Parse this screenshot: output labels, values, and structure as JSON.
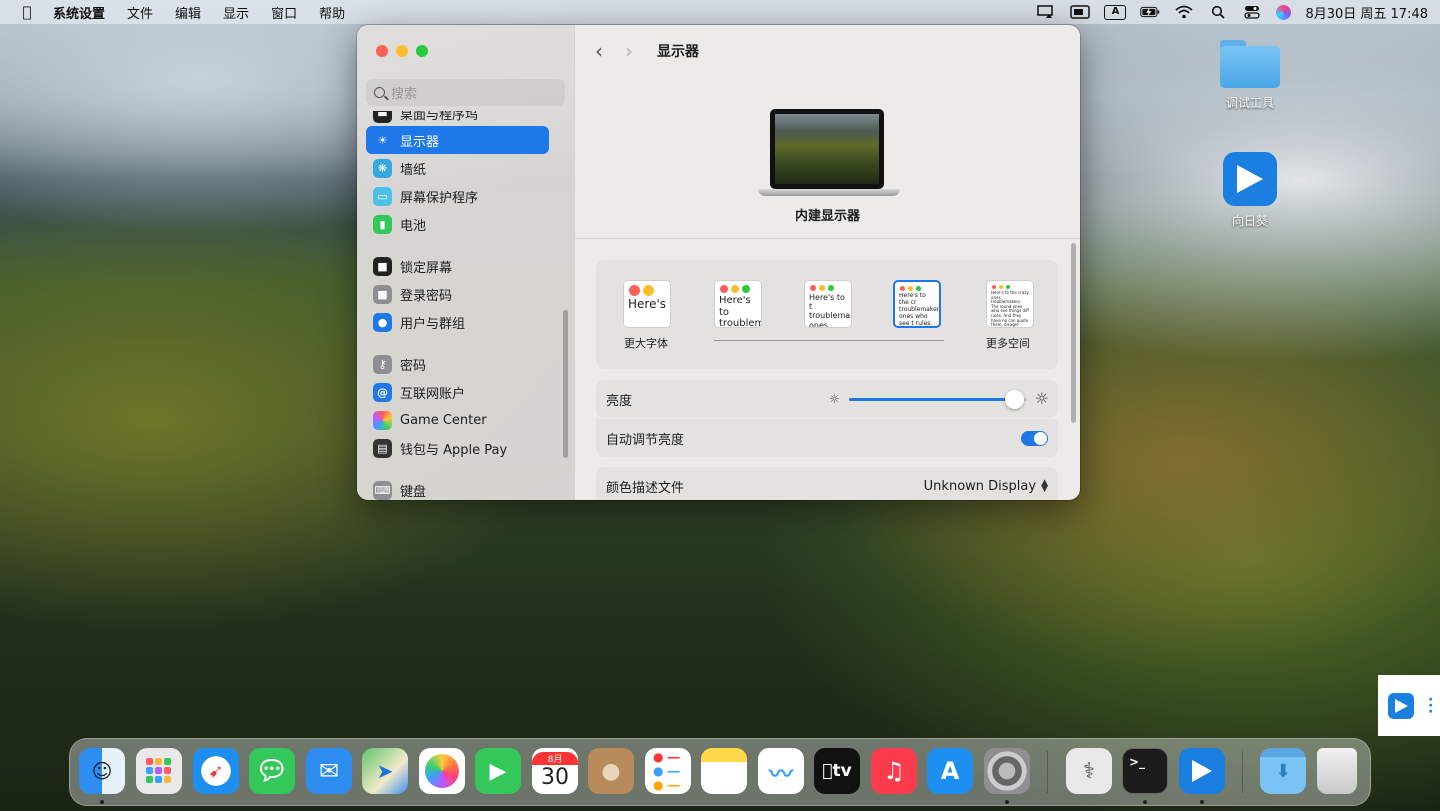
{
  "menubar": {
    "apple_icon": "apple-logo-icon",
    "items": [
      "系统设置",
      "文件",
      "编辑",
      "显示",
      "窗口",
      "帮助"
    ],
    "clock": "8月30日 周五 17:48",
    "input_source": "A"
  },
  "sidebar": {
    "search_placeholder": "搜索",
    "items": [
      {
        "label": "桌面与程序坞",
        "icon": "dock-icon",
        "color": "#222222"
      },
      {
        "label": "显示器",
        "icon": "sun-icon",
        "color": "#1f78e8"
      },
      {
        "label": "墙纸",
        "icon": "snowflake-icon",
        "color": "#34a8e0"
      },
      {
        "label": "屏幕保护程序",
        "icon": "screensaver-icon",
        "color": "#4cc0e8"
      },
      {
        "label": "电池",
        "icon": "battery-icon",
        "color": "#34c759"
      },
      {
        "label": "锁定屏幕",
        "icon": "lock-icon",
        "color": "#222222"
      },
      {
        "label": "登录密码",
        "icon": "padlock-icon",
        "color": "#8e8e93"
      },
      {
        "label": "用户与群组",
        "icon": "users-icon",
        "color": "#1f78e8"
      },
      {
        "label": "密码",
        "icon": "key-icon",
        "color": "#8e8e93"
      },
      {
        "label": "互联网账户",
        "icon": "at-icon",
        "color": "#1f78e8"
      },
      {
        "label": "Game Center",
        "icon": "game-center-icon",
        "color": "#f5f5f5"
      },
      {
        "label": "钱包与 Apple Pay",
        "icon": "wallet-icon",
        "color": "#333333"
      },
      {
        "label": "键盘",
        "icon": "keyboard-icon",
        "color": "#8e8e93"
      }
    ]
  },
  "main": {
    "title": "显示器",
    "display_name": "内建显示器",
    "resolution": {
      "options": [
        {
          "text": "Here's"
        },
        {
          "text": "Here's to troublem"
        },
        {
          "text": "Here's to t troublema ones who"
        },
        {
          "text": "Here's to the cr troublemakers ones who see t rules. And they"
        },
        {
          "text": "Here's to the crazy ones troublemakers. The round ones who see things diff rules. And they have no can quote them, disagre them. About the only thi Because they change t"
        }
      ],
      "label_left": "更大字体",
      "label_right": "更多空间",
      "selected_index": 3
    },
    "brightness_label": "亮度",
    "brightness_fraction": 0.93,
    "auto_brightness_label": "自动调节亮度",
    "auto_brightness_on": true,
    "color_profile_label": "颜色描述文件",
    "color_profile_value": "Unknown Display"
  },
  "desktop": {
    "icons": [
      {
        "label": "调试工具",
        "icon": "folder-icon"
      },
      {
        "label": "向日葵",
        "icon": "sunlogin-icon"
      }
    ]
  },
  "dock": {
    "calendar_month": "8月",
    "calendar_day": "30",
    "apps": [
      {
        "name": "finder-icon",
        "color": "#2e8df0"
      },
      {
        "name": "launchpad-icon",
        "color": "#e9e9e9"
      },
      {
        "name": "safari-icon",
        "color": "#1d8ff0"
      },
      {
        "name": "messages-icon",
        "color": "#34c759"
      },
      {
        "name": "mail-icon",
        "color": "#2d8cf0"
      },
      {
        "name": "maps-icon",
        "color": "#5fc46a"
      },
      {
        "name": "photos-icon",
        "color": "#ffffff"
      },
      {
        "name": "facetime-icon",
        "color": "#34c759"
      },
      {
        "name": "calendar-icon",
        "color": "#ffffff"
      },
      {
        "name": "contacts-icon",
        "color": "#b98b5a"
      },
      {
        "name": "reminders-icon",
        "color": "#ffffff"
      },
      {
        "name": "notes-icon",
        "color": "#ffd84a"
      },
      {
        "name": "freeform-icon",
        "color": "#ffffff"
      },
      {
        "name": "tv-icon",
        "color": "#111111"
      },
      {
        "name": "music-icon",
        "color": "#fa3c4c"
      },
      {
        "name": "app-store-icon",
        "color": "#1d8ff0"
      },
      {
        "name": "system-settings-icon",
        "color": "#8e8e93"
      },
      {
        "name": "disk-utility-icon",
        "color": "#e8e8e8"
      },
      {
        "name": "terminal-icon",
        "color": "#1c1c1c"
      },
      {
        "name": "sunlogin-icon",
        "color": "#1a7fe0"
      },
      {
        "name": "downloads-folder-icon",
        "color": "#6ab6ee"
      },
      {
        "name": "trash-icon",
        "color": "#d8d8d8"
      }
    ],
    "tv_label": "tv"
  }
}
